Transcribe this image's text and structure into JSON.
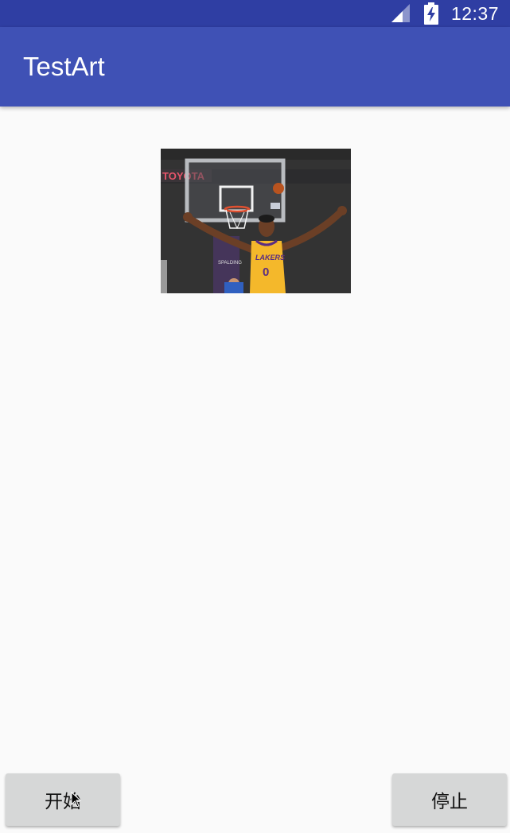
{
  "status_bar": {
    "time": "12:37",
    "signal_icon": "cell-signal-icon",
    "battery_icon": "battery-charging-icon"
  },
  "app_bar": {
    "title": "TestArt"
  },
  "image": {
    "banner_text": "TOYOTA",
    "jersey_brand": "LAKERS",
    "jersey_number": "0",
    "sponsor_text": "SPALDING"
  },
  "buttons": {
    "start_label": "开始",
    "stop_label": "停止"
  },
  "colors": {
    "status_bar": "#2f3ea3",
    "app_bar": "#3f51b5",
    "background": "#fafafa",
    "button": "#d6d7d7"
  }
}
